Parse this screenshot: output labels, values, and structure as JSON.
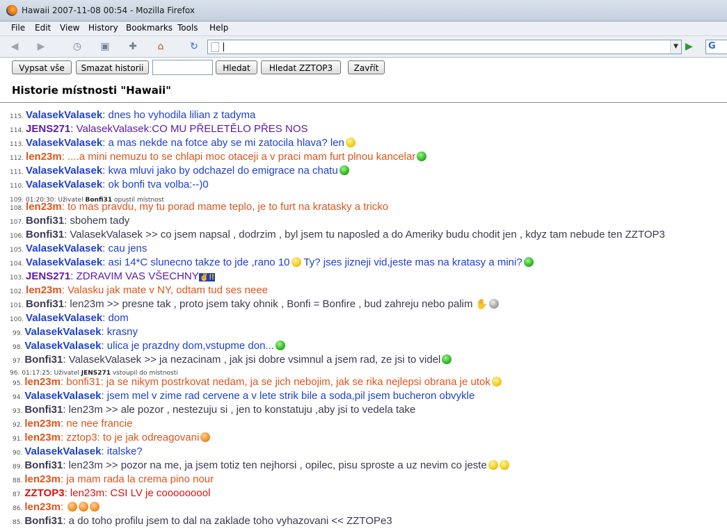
{
  "window": {
    "title": "Hawaii 2007-11-08 00:54 - Mozilla Firefox"
  },
  "menu": [
    "File",
    "Edit",
    "View",
    "History",
    "Bookmarks",
    "Tools",
    "Help"
  ],
  "icons": {
    "back": "back-icon",
    "forward": "forward-icon",
    "reload": "reload-icon",
    "home": "home-icon",
    "go": "go-arrow-icon",
    "search_engine": "google-icon"
  },
  "toolbar": {
    "list_all": "Vypsat vše",
    "clear_history": "Smazat historii",
    "search_value": "",
    "search": "Hledat",
    "search_zz": "Hledat ZZTOP3",
    "close": "Zavřít"
  },
  "page_title": "Historie místnosti \"Hawaii\"",
  "colors": {
    "valasek": "#1f3fd0",
    "jens": "#5a1aa8",
    "len": "#e0541a",
    "bonfi": "#3a3a50",
    "zztop": "#e01010"
  },
  "messages": [
    {
      "num": "115.",
      "nick": "ValasekValasek",
      "who": "valasek",
      "text": "dnes ho vyhodila lilian z tadyma"
    },
    {
      "num": "114.",
      "nick": "JENS271",
      "who": "jens",
      "text": "ValasekValasek:CO MU PŘELETĚLO PŘES NOS"
    },
    {
      "num": "113.",
      "nick": "ValasekValasek",
      "who": "valasek",
      "text": "a mas nekde na fotce aby se mi zatocila hlava? len",
      "smile": "y"
    },
    {
      "num": "112.",
      "nick": "len23m",
      "who": "len",
      "text": "....a mini nemuzu to se chlapi moc otaceji a v praci mam furt plnou kancelar",
      "smile": "g"
    },
    {
      "num": "111.",
      "nick": "ValasekValasek",
      "who": "valasek",
      "text": "kwa mluvi jako by odchazel do emigrace na chatu",
      "smile": "g"
    },
    {
      "num": "110.",
      "nick": "ValasekValasek",
      "who": "valasek",
      "text": "ok bonfi tva volba:--)0"
    },
    {
      "num": "109.",
      "sys": true,
      "pre": "01:20:30: Uživatel",
      "user": "Bonfi31",
      "post": "opustil místnost"
    },
    {
      "num": "108.",
      "nick": "len23m",
      "who": "len",
      "text": "to mas pravdu, my tu porad mame teplo, je to furt na kratasky a tricko"
    },
    {
      "num": "107.",
      "nick": "Bonfi31",
      "who": "bonfi",
      "text": "sbohem tady"
    },
    {
      "num": "106.",
      "nick": "Bonfi31",
      "who": "bonfi",
      "text": "ValasekValasek >> co jsem napsal , dodrzim , byl jsem tu naposled a do Ameriky budu chodit jen , kdyz tam nebude ten ZZTOP3"
    },
    {
      "num": "105.",
      "nick": "ValasekValasek",
      "who": "valasek",
      "text": "cau jens"
    },
    {
      "num": "104.",
      "nick": "ValasekValasek",
      "who": "valasek",
      "text": "asi 14*C slunecno takze to jde ,rano 10",
      "smile": "y",
      "text2": "Ty? jses jizneji vid,jeste mas na kratasy a mini?",
      "smile2": "g"
    },
    {
      "num": "103.",
      "nick": "JENS271",
      "who": "jens",
      "text": "ZDRAVIM VAS VŠECHNY",
      "hl": "✌!!"
    },
    {
      "num": "102.",
      "nick": "len23m",
      "who": "len",
      "text": "Valasku jak mate v NY, odtam tud ses neee"
    },
    {
      "num": "101.",
      "nick": "Bonfi31",
      "who": "bonfi",
      "text": "len23m >> presne tak , proto jsem taky ohnik , Bonfi = Bonfire , bud zahreju nebo palim",
      "hand": true,
      "smile": "gr"
    },
    {
      "num": "100.",
      "nick": "ValasekValasek",
      "who": "valasek",
      "text": "dom"
    },
    {
      "num": "99.",
      "nick": "ValasekValasek",
      "who": "valasek",
      "text": "krasny"
    },
    {
      "num": "98.",
      "nick": "ValasekValasek",
      "who": "valasek",
      "text": "ulica je prazdny dom,vstupme don...",
      "smile": "g"
    },
    {
      "num": "97.",
      "nick": "Bonfi31",
      "who": "bonfi",
      "text": "ValasekValasek >> ja nezacinam , jak jsi dobre vsimnul a jsem rad, ze jsi to videl",
      "smile": "g"
    },
    {
      "num": "96.",
      "sys": true,
      "pre": "01:17:25: Uživatel",
      "user": "JENS271",
      "post": "vstoupil do místnosti"
    },
    {
      "num": "95.",
      "nick": "len23m",
      "who": "len",
      "text": "bonfi31: ja se nikym postrkovat nedam, ja se jich nebojim, jak se rika nejlepsi obrana je utok",
      "smile": "y"
    },
    {
      "num": "94.",
      "nick": "ValasekValasek",
      "who": "valasek",
      "text": "jsem mel v zime rad cervene a v lete strik bile a soda,pil jsem bucheron obvykle"
    },
    {
      "num": "93.",
      "nick": "Bonfi31",
      "who": "bonfi",
      "text": "len23m >> ale pozor , nestezuju si , jen to konstatuju ,aby jsi to vedela take"
    },
    {
      "num": "92.",
      "nick": "len23m",
      "who": "len",
      "text": "ne nee francie"
    },
    {
      "num": "91.",
      "nick": "len23m",
      "who": "len",
      "text": "zztop3: to je jak odreagovani",
      "smile": "o"
    },
    {
      "num": "90.",
      "nick": "ValasekValasek",
      "who": "valasek",
      "text": "italske?"
    },
    {
      "num": "89.",
      "nick": "Bonfi31",
      "who": "bonfi",
      "text": "len23m >> pozor na me, ja jsem totiz ten nejhorsi , opilec, pisu sproste a uz nevim co jeste",
      "smile": "y",
      "smile2": "y"
    },
    {
      "num": "88.",
      "nick": "len23m",
      "who": "len",
      "text": "ja mam rada la crema pino nour"
    },
    {
      "num": "87.",
      "nick": "ZZTOP3",
      "who": "zztop",
      "text": "len23m: CSI LV je cooooooool"
    },
    {
      "num": "86.",
      "nick": "len23m",
      "who": "len",
      "text": "",
      "smiles3": true
    },
    {
      "num": "85.",
      "nick": "Bonfi31",
      "who": "bonfi",
      "text": "a do toho profilu jsem to dal na zaklade toho vyhazovani << ZZTOPe3"
    }
  ]
}
